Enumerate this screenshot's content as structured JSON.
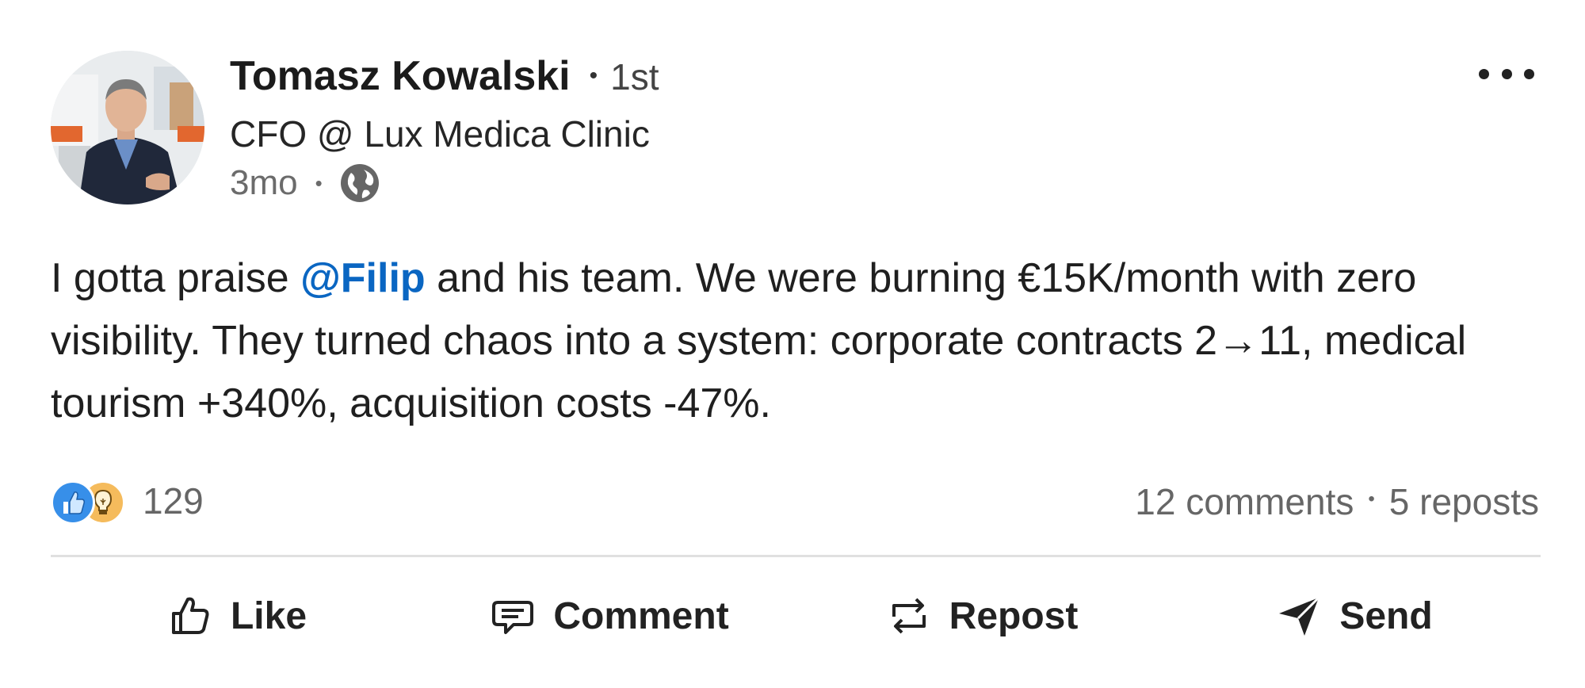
{
  "author": {
    "name": "Tomasz Kowalski",
    "degree": "1st",
    "headline": "CFO @ Lux Medica Clinic",
    "time": "3mo",
    "visibility_icon": "globe-icon"
  },
  "post": {
    "text_before": "I gotta praise ",
    "mention": "@Filip",
    "text_after": " and his team. We were burning €15K/month with zero visibility. They turned chaos into a system: corporate contracts 2→11, medical tourism +340%, acquisition costs -47%."
  },
  "social": {
    "reaction_icons": [
      "like-icon",
      "insightful-icon"
    ],
    "reaction_count": "129",
    "comments": "12 comments",
    "reposts": "5 reposts"
  },
  "actions": {
    "like": "Like",
    "comment": "Comment",
    "repost": "Repost",
    "send": "Send"
  },
  "colors": {
    "mention": "#0a66c2",
    "like_reaction": "#378fe9",
    "insight_reaction": "#f5bb5c"
  }
}
